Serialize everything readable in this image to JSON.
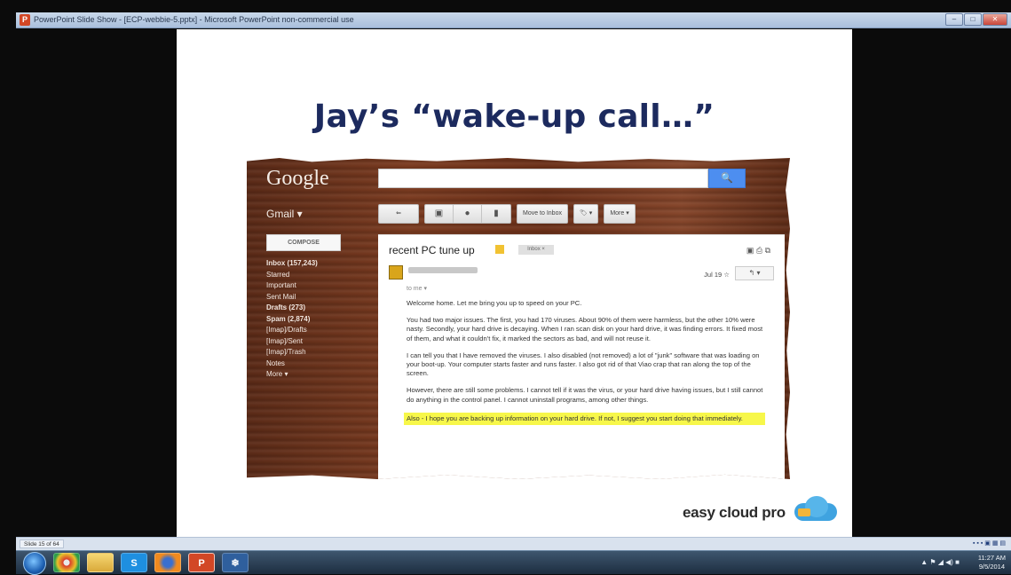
{
  "window": {
    "title": "PowerPoint Slide Show - [ECP-webbie-5.pptx] - Microsoft PowerPoint non-commercial use",
    "app_icon": "P",
    "buttons": [
      "–",
      "□",
      "✕"
    ]
  },
  "slide": {
    "title": "Jay’s “wake-up call…”",
    "logo_text": "easy cloud pro"
  },
  "gmail": {
    "logo": "Google",
    "search_button": "🔍",
    "label": "Gmail ▾",
    "toolbar": {
      "back": "⇐",
      "archive": "▣",
      "spam": "●",
      "delete": "▮",
      "move_to_inbox": "Move to Inbox",
      "labels": "🏷 ▾",
      "more": "More ▾"
    },
    "compose": "COMPOSE",
    "sidebar": [
      {
        "label": "Inbox (157,243)",
        "bold": true
      },
      {
        "label": "Starred",
        "bold": false
      },
      {
        "label": "Important",
        "bold": false
      },
      {
        "label": "Sent Mail",
        "bold": false
      },
      {
        "label": "Drafts (273)",
        "bold": true
      },
      {
        "label": "Spam (2,874)",
        "bold": true
      },
      {
        "label": "[Imap]/Drafts",
        "bold": false
      },
      {
        "label": "[Imap]/Sent",
        "bold": false
      },
      {
        "label": "[Imap]/Trash",
        "bold": false
      },
      {
        "label": "Notes",
        "bold": false
      },
      {
        "label": "More ▾",
        "bold": false
      }
    ],
    "mail": {
      "subject": "recent PC tune up",
      "inbox_tag": "Inbox ×",
      "icons": "▣ ⎙ ⧉",
      "to": "to me ▾",
      "date": "Jul 19 ☆",
      "reply": "↰ ▾",
      "paragraphs": [
        "Welcome home. Let me bring you up to speed on your PC.",
        "You had two major issues. The first, you had 170 viruses. About 90% of them were harmless, but the other 10% were nasty. Secondly, your hard drive is decaying. When I ran scan disk on your hard drive, it was finding errors. It fixed most of them, and what it couldn't fix, it marked the sectors as bad, and will not reuse it.",
        "I can tell you that I have removed the viruses. I also disabled (not removed) a lot of \"junk\" software that was loading on your boot-up. Your computer starts faster and runs faster. I also got rid of that Viao crap that ran along the top of the screen.",
        "However, there are still some problems. I cannot tell if it was the virus, or your hard drive having issues, but I still cannot do anything in the control panel. I cannot uninstall programs, among other things.",
        "Also - I hope you are backing up information on your hard drive. If not, I suggest you start doing that immediately."
      ]
    }
  },
  "statusbar": {
    "slide_count": "Slide 15 of 64",
    "icons": "▪ ▪ ▪ ▣ ▦ ▤"
  },
  "taskbar": {
    "apps": [
      "chrome",
      "explorer",
      "skype",
      "firefox",
      "powerpoint",
      "snow"
    ],
    "app_glyphs": [
      "",
      "",
      "S",
      "",
      "P",
      "❄"
    ],
    "tray": "▲ ⚑ ◢ ◀) ■",
    "time": "11:27 AM",
    "date": "9/5/2014"
  },
  "colors": {
    "title": "#1c2a5e",
    "highlight": "#f7f74a",
    "search_button": "#4d8ef0"
  }
}
